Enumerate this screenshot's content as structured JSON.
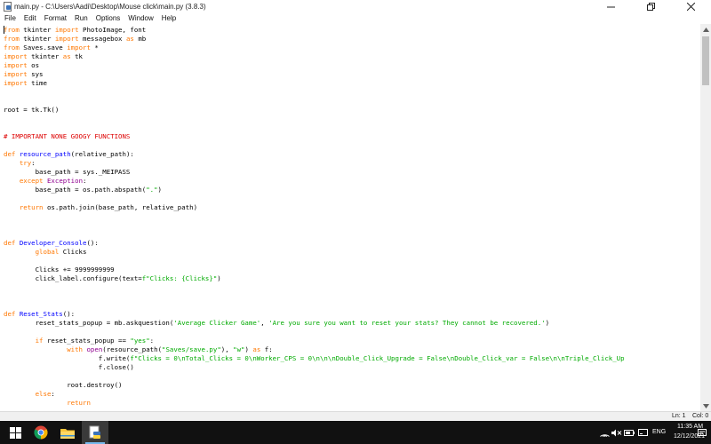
{
  "window": {
    "title": "main.py - C:\\Users\\Aadi\\Desktop\\Mouse click\\main.py (3.8.3)",
    "minimize_symbol": "—",
    "maximize_symbol": "❐",
    "close_symbol": "✕"
  },
  "menu": [
    "File",
    "Edit",
    "Format",
    "Run",
    "Options",
    "Window",
    "Help"
  ],
  "code_lines": [
    [
      [
        "kw",
        "from"
      ],
      [
        "t",
        " tkinter "
      ],
      [
        "kw",
        "import"
      ],
      [
        "t",
        " PhotoImage, font"
      ]
    ],
    [
      [
        "kw",
        "from"
      ],
      [
        "t",
        " tkinter "
      ],
      [
        "kw",
        "import"
      ],
      [
        "t",
        " messagebox "
      ],
      [
        "kw",
        "as"
      ],
      [
        "t",
        " mb"
      ]
    ],
    [
      [
        "kw",
        "from"
      ],
      [
        "t",
        " Saves.save "
      ],
      [
        "kw",
        "import"
      ],
      [
        "t",
        " *"
      ]
    ],
    [
      [
        "kw",
        "import"
      ],
      [
        "t",
        " tkinter "
      ],
      [
        "kw",
        "as"
      ],
      [
        "t",
        " tk"
      ]
    ],
    [
      [
        "kw",
        "import"
      ],
      [
        "t",
        " os"
      ]
    ],
    [
      [
        "kw",
        "import"
      ],
      [
        "t",
        " sys"
      ]
    ],
    [
      [
        "kw",
        "import"
      ],
      [
        "t",
        " time"
      ]
    ],
    [],
    [],
    [
      [
        "t",
        "root = tk.Tk()"
      ]
    ],
    [],
    [],
    [
      [
        "cmt",
        "# IMPORTANT NONE GOOGY FUNCTIONS"
      ]
    ],
    [],
    [
      [
        "kw",
        "def"
      ],
      [
        "t",
        " "
      ],
      [
        "def",
        "resource_path"
      ],
      [
        "t",
        "(relative_path):"
      ]
    ],
    [
      [
        "t",
        "    "
      ],
      [
        "kw",
        "try"
      ],
      [
        "t",
        ":"
      ]
    ],
    [
      [
        "t",
        "        base_path = sys._MEIPASS"
      ]
    ],
    [
      [
        "t",
        "    "
      ],
      [
        "kw",
        "except"
      ],
      [
        "t",
        " "
      ],
      [
        "bi",
        "Exception"
      ],
      [
        "t",
        ":"
      ]
    ],
    [
      [
        "t",
        "        base_path = os.path.abspath("
      ],
      [
        "str",
        "\".\""
      ],
      [
        "t",
        ")"
      ]
    ],
    [],
    [
      [
        "t",
        "    "
      ],
      [
        "kw",
        "return"
      ],
      [
        "t",
        " os.path.join(base_path, relative_path)"
      ]
    ],
    [],
    [],
    [],
    [
      [
        "kw",
        "def"
      ],
      [
        "t",
        " "
      ],
      [
        "def",
        "Developer_Console"
      ],
      [
        "t",
        "():"
      ]
    ],
    [
      [
        "t",
        "        "
      ],
      [
        "kw",
        "global"
      ],
      [
        "t",
        " Clicks"
      ]
    ],
    [],
    [
      [
        "t",
        "        Clicks += 9999999999"
      ]
    ],
    [
      [
        "t",
        "        click_label.configure(text="
      ],
      [
        "str",
        "f\"Clicks: {Clicks}\""
      ],
      [
        "t",
        ")"
      ]
    ],
    [],
    [],
    [],
    [
      [
        "kw",
        "def"
      ],
      [
        "t",
        " "
      ],
      [
        "def",
        "Reset_Stats"
      ],
      [
        "t",
        "():"
      ]
    ],
    [
      [
        "t",
        "        reset_stats_popup = mb.askquestion("
      ],
      [
        "str",
        "'Average Clicker Game'"
      ],
      [
        "t",
        ", "
      ],
      [
        "str",
        "'Are you sure you want to reset your stats? They cannot be recovered.'"
      ],
      [
        "t",
        ")"
      ]
    ],
    [],
    [
      [
        "t",
        "        "
      ],
      [
        "kw",
        "if"
      ],
      [
        "t",
        " reset_stats_popup == "
      ],
      [
        "str",
        "\"yes\""
      ],
      [
        "t",
        ":"
      ]
    ],
    [
      [
        "t",
        "                "
      ],
      [
        "kw",
        "with"
      ],
      [
        "t",
        " "
      ],
      [
        "bi",
        "open"
      ],
      [
        "t",
        "(resource_path("
      ],
      [
        "str",
        "\"Saves/save.py\""
      ],
      [
        "t",
        "), "
      ],
      [
        "str",
        "\"w\""
      ],
      [
        "t",
        ") "
      ],
      [
        "kw",
        "as"
      ],
      [
        "t",
        " f:"
      ]
    ],
    [
      [
        "t",
        "                        f.write("
      ],
      [
        "str",
        "f\"Clicks = 0\\nTotal_Clicks = 0\\nWorker_CPS = 0\\n\\n\\nDouble_Click_Upgrade = False\\nDouble_Click_var = False\\n\\nTriple_Click_Up"
      ]
    ],
    [
      [
        "t",
        "                        f.close()"
      ]
    ],
    [],
    [
      [
        "t",
        "                root.destroy()"
      ]
    ],
    [
      [
        "t",
        "        "
      ],
      [
        "kw",
        "else"
      ],
      [
        "t",
        ":"
      ]
    ],
    [
      [
        "t",
        "                "
      ],
      [
        "kw",
        "return"
      ]
    ]
  ],
  "status": {
    "line": "Ln: 1",
    "col": "Col: 0"
  },
  "taskbar": {
    "time": "11:35 AM",
    "date": "12/12/2021",
    "language": "ENG",
    "apps": [
      "windows-start",
      "chrome",
      "file-explorer",
      "python-idle"
    ]
  },
  "colors": {
    "keyword": "#ff7700",
    "string": "#00aa00",
    "comment": "#dd0000",
    "definition": "#0000ff",
    "builtin": "#900090",
    "taskbar": "#111111"
  }
}
